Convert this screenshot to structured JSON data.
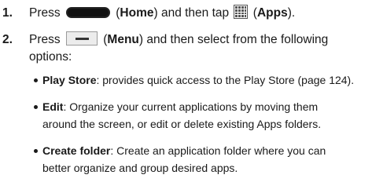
{
  "step1": {
    "number": "1.",
    "press": "Press",
    "home": "Home",
    "then_tap": "and then tap",
    "apps": "Apps"
  },
  "step2": {
    "number": "2.",
    "press": "Press",
    "menu": "Menu",
    "line1_rest": "and then select from the following",
    "line2": "options:",
    "bullets": [
      {
        "term": "Play Store",
        "lines": [
          "provides quick access to the Play Store (page 124)."
        ]
      },
      {
        "term": "Edit",
        "lines": [
          "Organize your current applications by moving them",
          "around the screen, or edit or delete existing Apps folders."
        ]
      },
      {
        "term": "Create folder",
        "lines": [
          "Create an application folder where you can",
          "better organize and group desired apps."
        ]
      }
    ]
  },
  "icons": {
    "home": "home-button-icon",
    "apps": "apps-grid-icon",
    "menu": "menu-button-icon"
  }
}
